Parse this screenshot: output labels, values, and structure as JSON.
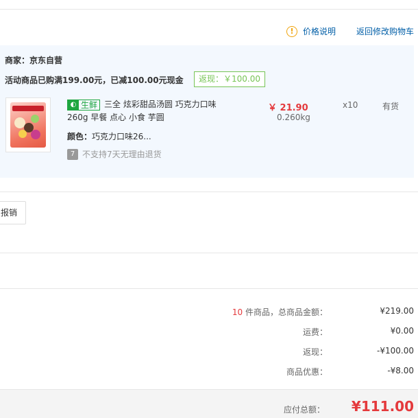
{
  "top": {
    "price_info_icon": "warning-circle-icon",
    "price_info_label": "价格说明",
    "back_to_cart": "返回修改购物车"
  },
  "shop": {
    "seller": "商家：京东自营",
    "promo_text": "活动商品已购满199.00元，已减100.00元现金",
    "cashback_tag": "返现：￥100.00"
  },
  "product": {
    "fresh_icon": "bowl-icon",
    "fresh_label": "生鲜",
    "name": "三全 炫彩甜品汤圆 巧克力口味 260g 早餐 点心 小食 芋圆",
    "color_label": "颜色：",
    "color_value": "巧克力口味26...",
    "price": "￥ 21.90",
    "weight": "0.260kg",
    "qty": "x10",
    "stock": "有货",
    "no_return": "不支持7天无理由退货"
  },
  "invoice_button": "报销",
  "summary": {
    "count": "10",
    "count_suffix": " 件商品，总商品金额：",
    "total_goods": "¥219.00",
    "shipping_label": "运费：",
    "shipping": "¥0.00",
    "cashback_label": "返现：",
    "cashback": "-¥100.00",
    "discount_label": "商品优惠：",
    "discount": "-¥8.00"
  },
  "total": {
    "label": "应付总额：",
    "value": "¥111.00"
  },
  "colors": {
    "accent_red": "#e4393c",
    "link_blue": "#005ea7",
    "fresh_green": "#1ea640",
    "cashback_green": "#76c454",
    "shop_bg": "#f3f8fe"
  }
}
